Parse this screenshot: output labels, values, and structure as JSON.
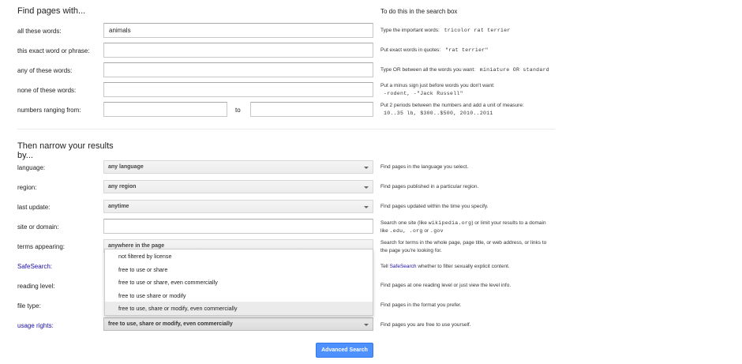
{
  "section1": {
    "heading": "Find pages with...",
    "help_heading": "To do this in the search box"
  },
  "rows1": {
    "all_words": {
      "label": "all these words:",
      "value": "animals",
      "help": "Type the important words:",
      "example": "tricolor rat terrier"
    },
    "exact": {
      "label": "this exact word or phrase:",
      "value": "",
      "help": "Put exact words in quotes:",
      "example": "\"rat terrier\""
    },
    "any": {
      "label": "any of these words:",
      "value": "",
      "help": "Type OR between all the words you want:",
      "example": "miniature OR standard"
    },
    "none": {
      "label": "none of these words:",
      "value": "",
      "help": "Put a minus sign just before words you don't want:",
      "example": "-rodent, -\"Jack Russell\""
    },
    "numbers": {
      "label": "numbers ranging from:",
      "from_value": "",
      "to_label": "to",
      "to_value": "",
      "help": "Put 2 periods between the numbers and add a unit of measure:",
      "example": "10..35 lb, $300..$500, 2010..2011"
    }
  },
  "section2": {
    "heading_line1": "Then narrow your results",
    "heading_line2": "by..."
  },
  "rows2": {
    "language": {
      "label": "language:",
      "value": "any language",
      "help": "Find pages in the language you select."
    },
    "region": {
      "label": "region:",
      "value": "any region",
      "help": "Find pages published in a particular region."
    },
    "last_update": {
      "label": "last update:",
      "value": "anytime",
      "help": "Find pages updated within the time you specify."
    },
    "site": {
      "label": "site or domain:",
      "value": "",
      "help_pre": "Search one site (like",
      "help_ex1": "wikipedia.org",
      "help_mid": ") or limit your results to a domain",
      "help_line2_pre": "like",
      "help_ex2": ".edu, .org",
      "help_or": "or",
      "help_ex3": ".gov"
    },
    "terms": {
      "label": "terms appearing:",
      "value": "anywhere in the page",
      "help_line1": "Search for terms in the whole page, page title, or web address, or links to",
      "help_line2": "the page you're looking for."
    },
    "safesearch": {
      "label": "SafeSearch:",
      "help_pre": "Tell",
      "help_link": "SafeSearch",
      "help_post": "whether to filter sexually explicit content."
    },
    "reading_level": {
      "label": "reading level:",
      "help": "Find pages at one reading level or just view the level info."
    },
    "file_type": {
      "label": "file type:",
      "help": "Find pages in the format you prefer."
    },
    "usage_rights": {
      "label": "usage rights:",
      "value": "free to use, share or modify, even commercially",
      "help": "Find pages you are free to use yourself."
    }
  },
  "usage_dropdown": {
    "options": [
      "not filtered by license",
      "free to use or share",
      "free to use or share, even commercially",
      "free to use share or modify",
      "free to use, share or modify, even commercially"
    ]
  },
  "submit_label": "Advanced Search",
  "colors": {
    "accent": "#4d90fe",
    "link": "#1a0dab"
  }
}
